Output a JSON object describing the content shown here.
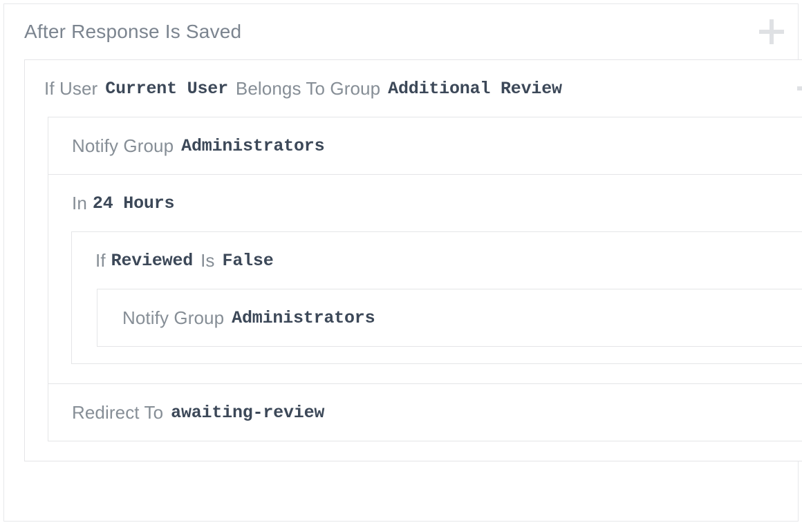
{
  "card": {
    "title": "After Response Is Saved",
    "add_icon": "plus-icon"
  },
  "colors": {
    "label": "#868e96",
    "value": "#3c4858",
    "title": "#7b848f",
    "border": "#e4e5e7",
    "plus": "#dfe1e4",
    "background": "#ffffff"
  },
  "rules": {
    "condition": {
      "if_label": "If User",
      "subject_value": "Current User",
      "operator_label": "Belongs To Group",
      "object_value": "Additional Review"
    },
    "actions": {
      "notify": {
        "label": "Notify Group",
        "value": "Administrators"
      },
      "delay": {
        "label": "In",
        "value": "24 Hours"
      },
      "nested_condition": {
        "if_label": "If",
        "subject_value": "Reviewed",
        "operator_label": "Is",
        "object_value": "False"
      },
      "nested_notify": {
        "label": "Notify Group",
        "value": "Administrators"
      },
      "redirect": {
        "label": "Redirect To",
        "value": "awaiting-review"
      }
    }
  }
}
